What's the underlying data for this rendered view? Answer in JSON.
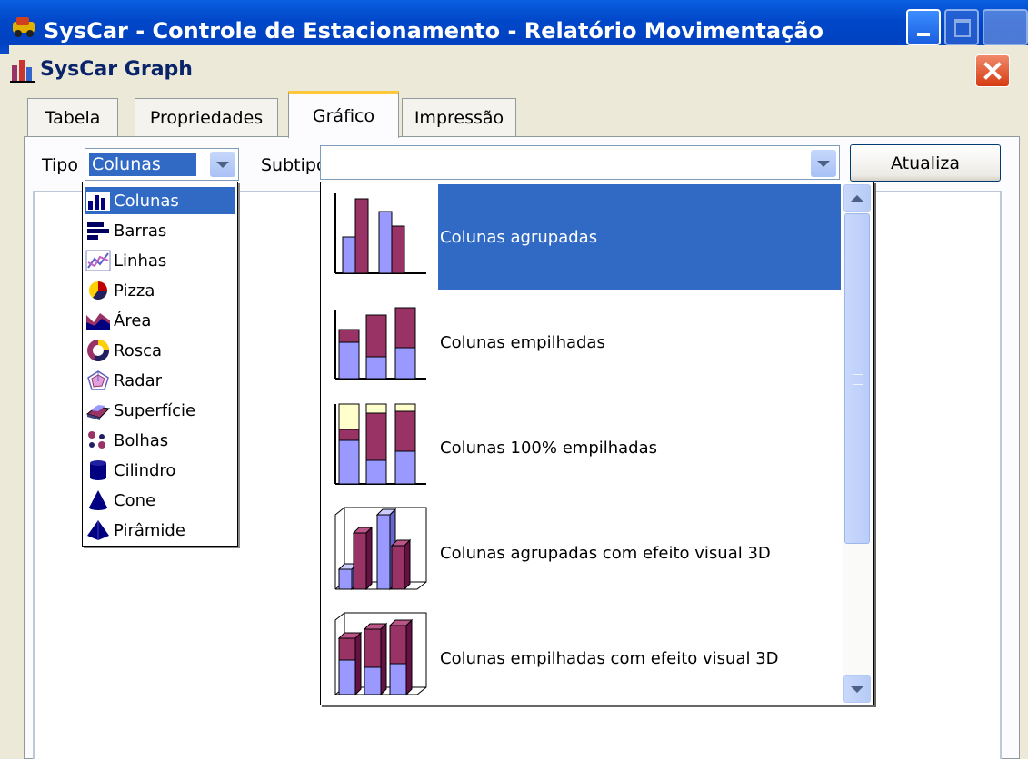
{
  "window": {
    "title": "SysCar - Controle de Estacionamento - Relatório Movimentação"
  },
  "dialog": {
    "title": "SysCar Graph"
  },
  "tabs": [
    {
      "label": "Tabela"
    },
    {
      "label": "Propriedades"
    },
    {
      "label": "Gráfico"
    },
    {
      "label": "Impressão"
    }
  ],
  "toolbar": {
    "tipo_label": "Tipo",
    "tipo_value": "Colunas",
    "subtipo_label": "Subtipo",
    "subtipo_value": "",
    "refresh_label": "Atualiza"
  },
  "tipo_options": [
    {
      "label": "Colunas",
      "icon": "column-chart-icon"
    },
    {
      "label": "Barras",
      "icon": "bar-chart-icon"
    },
    {
      "label": "Linhas",
      "icon": "line-chart-icon"
    },
    {
      "label": "Pizza",
      "icon": "pie-chart-icon"
    },
    {
      "label": "Área",
      "icon": "area-chart-icon"
    },
    {
      "label": "Rosca",
      "icon": "doughnut-chart-icon"
    },
    {
      "label": "Radar",
      "icon": "radar-chart-icon"
    },
    {
      "label": "Superfície",
      "icon": "surface-chart-icon"
    },
    {
      "label": "Bolhas",
      "icon": "bubble-chart-icon"
    },
    {
      "label": "Cilindro",
      "icon": "cylinder-chart-icon"
    },
    {
      "label": "Cone",
      "icon": "cone-chart-icon"
    },
    {
      "label": "Pirâmide",
      "icon": "pyramid-chart-icon"
    }
  ],
  "subtipo_options": [
    {
      "label": "Colunas agrupadas",
      "icon": "clustered-columns-icon"
    },
    {
      "label": "Colunas empilhadas",
      "icon": "stacked-columns-icon"
    },
    {
      "label": "Colunas 100% empilhadas",
      "icon": "stacked-100-columns-icon"
    },
    {
      "label": "Colunas agrupadas com efeito visual 3D",
      "icon": "clustered-columns-3d-icon"
    },
    {
      "label": "Colunas empilhadas com efeito visual 3D",
      "icon": "stacked-columns-3d-icon"
    }
  ],
  "colors": {
    "selection": "#316ac5",
    "bar_blue": "#9999ff",
    "bar_maroon": "#993366",
    "bar_cream": "#ffffcc"
  }
}
